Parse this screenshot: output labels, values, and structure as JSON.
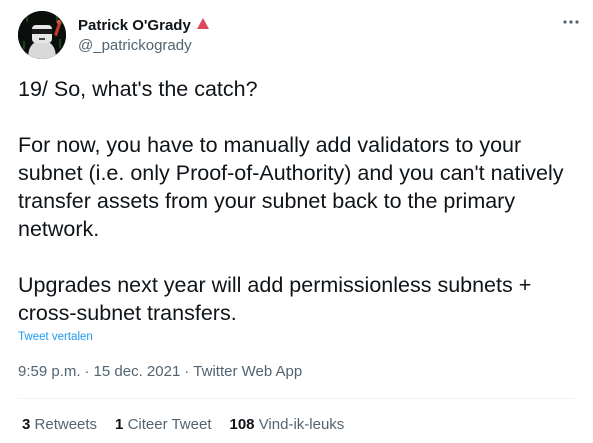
{
  "author": {
    "name": "Patrick O'Grady",
    "handle": "@_patrickogrady",
    "badge_color": "#e0455a"
  },
  "tweet": {
    "paragraphs": [
      "19/ So, what's the catch?",
      "For now, you have to manually add validators to your subnet (i.e. only Proof-of-Authority) and you can't natively transfer assets from your subnet back to the primary network.",
      "Upgrades next year will add permissionless subnets + cross-subnet transfers."
    ],
    "translate_label": "Tweet vertalen",
    "time": "9:59 p.m.",
    "date": "15 dec. 2021",
    "source": "Twitter Web App",
    "separator": "·"
  },
  "stats": [
    {
      "count": "3",
      "label": "Retweets"
    },
    {
      "count": "1",
      "label": "Citeer Tweet"
    },
    {
      "count": "108",
      "label": "Vind-ik-leuks"
    }
  ],
  "icons": {
    "more": "more-options-icon",
    "badge": "triangle-badge-icon"
  },
  "colors": {
    "link": "#1d9bf0",
    "secondary_text": "#536471",
    "primary_text": "#0f1419"
  }
}
